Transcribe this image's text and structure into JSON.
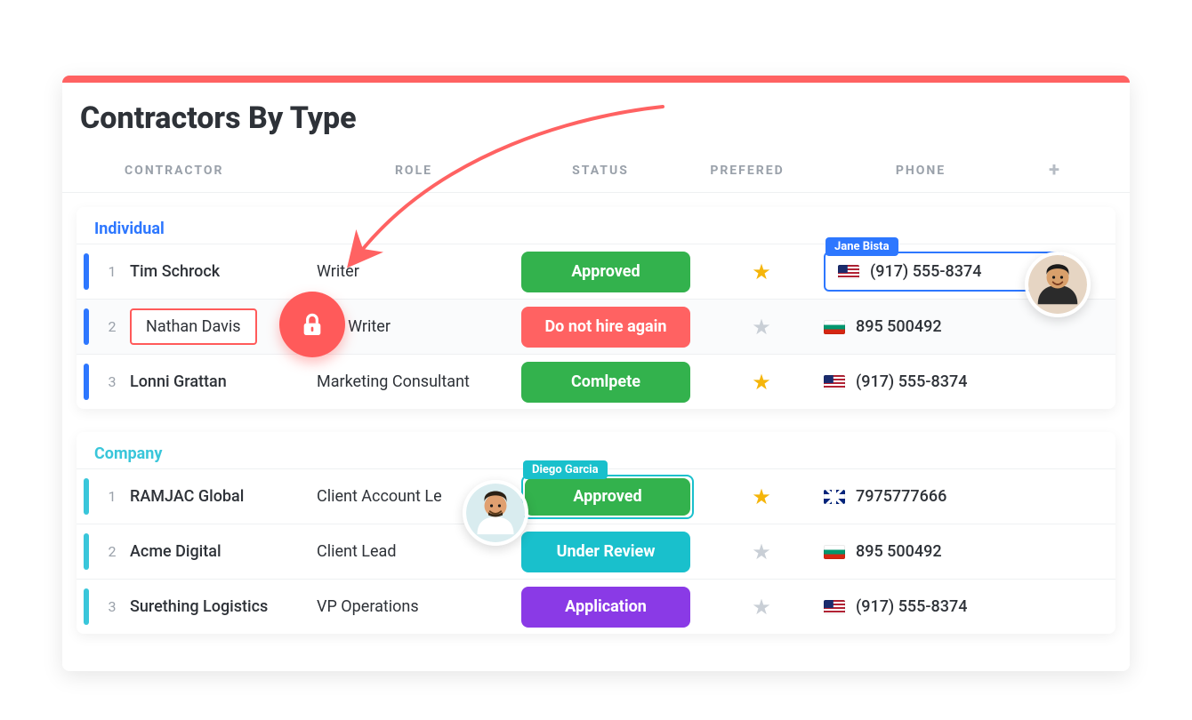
{
  "title": "Contractors By Type",
  "headers": {
    "contractor": "CONTRACTOR",
    "role": "ROLE",
    "status": "STATUS",
    "prefered": "PREFERED",
    "phone": "PHONE"
  },
  "sections": {
    "individual": {
      "label": "Individual",
      "rows": [
        {
          "idx": "1",
          "name": "Tim Schrock",
          "role": "Writer",
          "status_label": "Approved",
          "status_class": "status-approved",
          "starred": true,
          "flag": "us",
          "phone": "(917) 555-8374",
          "phone_highlight_user": "Jane Bista"
        },
        {
          "idx": "2",
          "name": "Nathan Davis",
          "role_full": "Senior Writer",
          "role_visible": "nior Writer",
          "status_label": "Do not hire again",
          "status_class": "status-donot",
          "starred": false,
          "flag": "bg",
          "phone": "895 500492",
          "locked": true
        },
        {
          "idx": "3",
          "name": "Lonni Grattan",
          "role": "Marketing Consultant",
          "status_label": "Comlpete",
          "status_class": "status-complete",
          "starred": true,
          "flag": "us",
          "phone": "(917) 555-8374"
        }
      ]
    },
    "company": {
      "label": "Company",
      "rows": [
        {
          "idx": "1",
          "name": "RAMJAC Global",
          "role_visible": "Client Account Le",
          "role_full": "Client Account Lead",
          "status_label": "Approved",
          "status_class": "status-approved",
          "status_highlight_user": "Diego Garcia",
          "starred": true,
          "flag": "gb",
          "phone": "7975777666"
        },
        {
          "idx": "2",
          "name": "Acme Digital",
          "role": "Client Lead",
          "status_label": "Under Review",
          "status_class": "status-review",
          "starred": false,
          "flag": "bg",
          "phone": "895 500492"
        },
        {
          "idx": "3",
          "name": "Surething Logistics",
          "role": "VP Operations",
          "status_label": "Application",
          "status_class": "status-application",
          "starred": false,
          "flag": "us",
          "phone": "(917) 555-8374"
        }
      ]
    }
  },
  "colors": {
    "accent_red": "#ff6262",
    "accent_blue": "#2d77ff",
    "accent_teal": "#19c0cc",
    "star_on": "#f5b50a",
    "star_off": "#c9cfd6"
  }
}
